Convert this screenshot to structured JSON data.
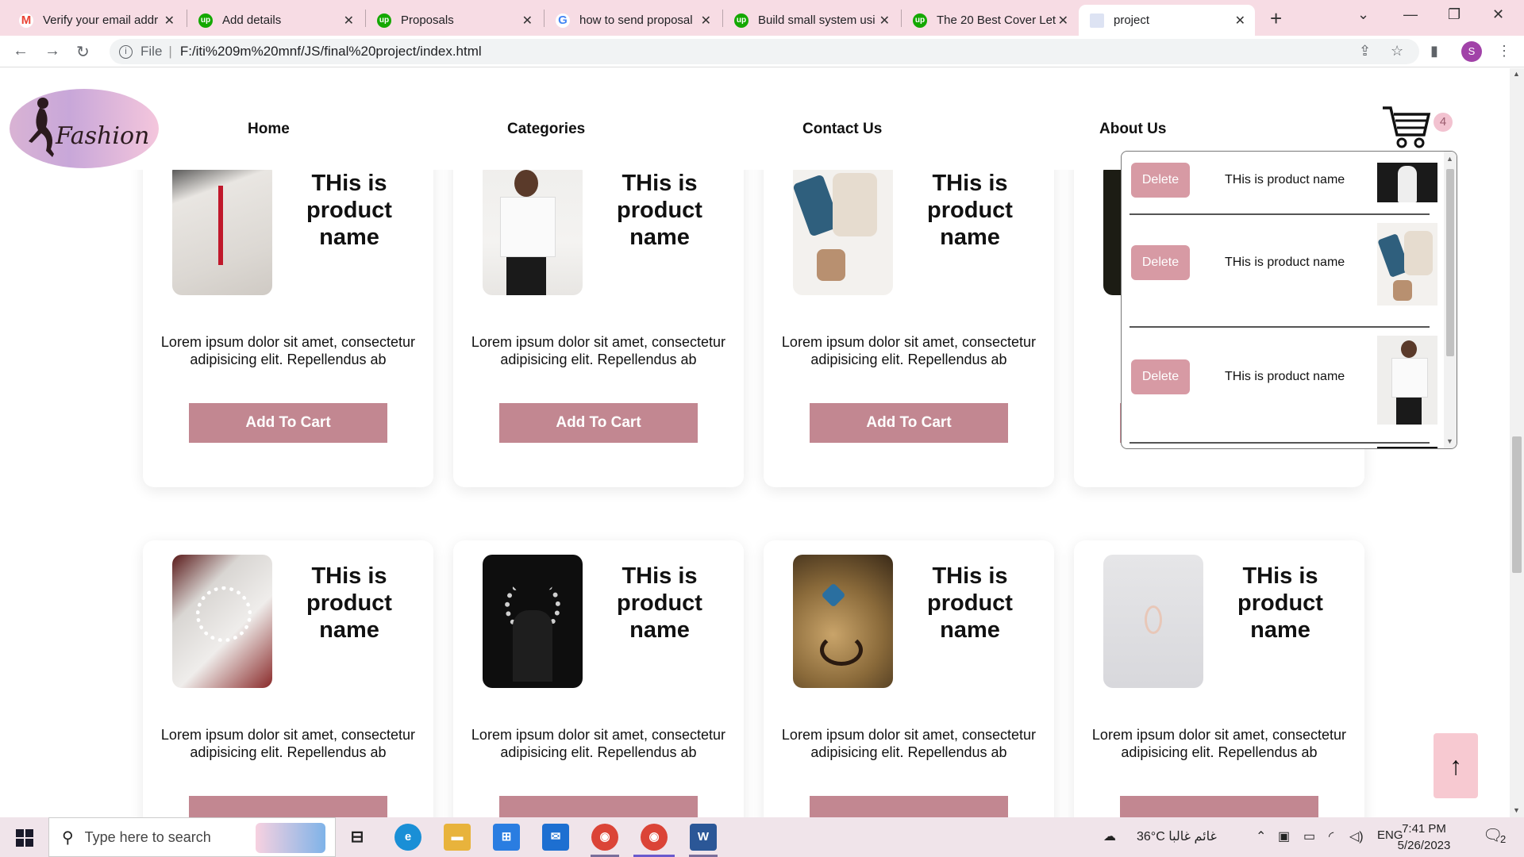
{
  "browser": {
    "tabs": [
      {
        "title": "Verify your email addr",
        "favicon": "gmail-icon",
        "color": "#ea4335",
        "glyph": "M"
      },
      {
        "title": "Add details",
        "favicon": "upwork-icon",
        "color": "#14a800",
        "glyph": "up"
      },
      {
        "title": "Proposals",
        "favicon": "upwork-icon",
        "color": "#14a800",
        "glyph": "up"
      },
      {
        "title": "how to send proposal",
        "favicon": "google-icon",
        "color": "#4285f4",
        "glyph": "G"
      },
      {
        "title": "Build small system usi",
        "favicon": "upwork-icon",
        "color": "#14a800",
        "glyph": "up"
      },
      {
        "title": "The 20 Best Cover Let",
        "favicon": "upwork-icon",
        "color": "#14a800",
        "glyph": "up"
      },
      {
        "title": "project",
        "favicon": "page-icon",
        "color": "#8899cc",
        "glyph": "",
        "active": true
      }
    ],
    "address": {
      "scheme_label": "File",
      "url": "F:/iti%209m%20mnf/JS/final%20project/index.html"
    },
    "profile_initial": "S"
  },
  "site": {
    "logo_text": "Fashion",
    "nav": [
      "Home",
      "Categories",
      "Contact Us",
      "About Us"
    ],
    "cart_count": "4"
  },
  "products_row1": [
    {
      "name": "THis is product name",
      "desc": "Lorem ipsum dolor sit amet, consectetur adipisicing elit. Repellendus ab",
      "button": "Add To Cart",
      "image": "fleece-jacket"
    },
    {
      "name": "THis is product name",
      "desc": "Lorem ipsum dolor sit amet, consectetur adipisicing elit. Repellendus ab",
      "button": "Add To Cart",
      "image": "tshirt-model"
    },
    {
      "name": "THis is product name",
      "desc": "Lorem ipsum dolor sit amet, consectetur adipisicing elit. Repellendus ab",
      "button": "Add To Cart",
      "image": "outfit-flatlay"
    }
  ],
  "products_row2": [
    {
      "name": "THis is product name",
      "desc": "Lorem ipsum dolor sit amet, consectetur adipisicing elit. Repellendus ab",
      "image": "pearl-necklace"
    },
    {
      "name": "THis is product name",
      "desc": "Lorem ipsum dolor sit amet, consectetur adipisicing elit. Repellendus ab",
      "image": "diamond-necklace"
    },
    {
      "name": "THis is product name",
      "desc": "Lorem ipsum dolor sit amet, consectetur adipisicing elit. Repellendus ab",
      "image": "gold-necklace"
    },
    {
      "name": "THis is product name",
      "desc": "Lorem ipsum dolor sit amet, consectetur adipisicing elit. Repellendus ab",
      "image": "ring"
    }
  ],
  "cart_items": [
    {
      "delete_label": "Delete",
      "name": "THis is product name",
      "image": "wedding-dress"
    },
    {
      "delete_label": "Delete",
      "name": "THis is product name",
      "image": "outfit-flatlay"
    },
    {
      "delete_label": "Delete",
      "name": "THis is product name",
      "image": "tshirt-model"
    }
  ],
  "scroll_top_glyph": "↑",
  "taskbar": {
    "search_placeholder": "Type here to search",
    "weather": "36°C  غائم غالبا",
    "lang": "ENG",
    "time": "7:41 PM",
    "date": "5/26/2023",
    "notifications": "2"
  },
  "colors": {
    "accent": "#c28791",
    "delete": "#d79aa4",
    "tabbar": "#f7dce4",
    "scroll_top": "#f7c9d1"
  }
}
